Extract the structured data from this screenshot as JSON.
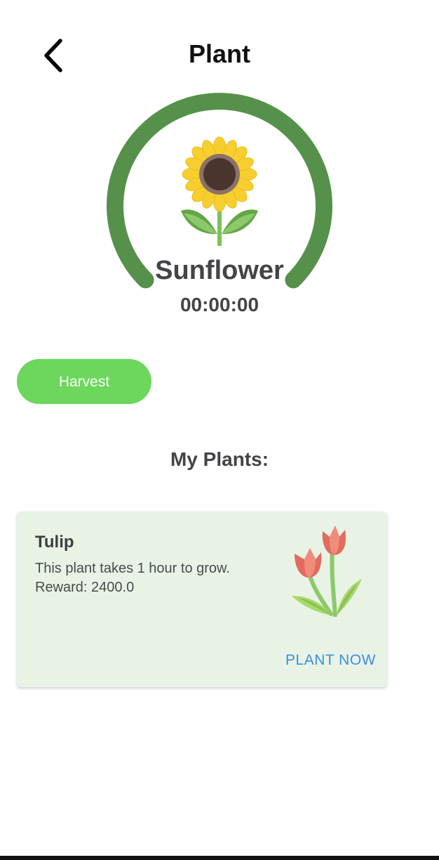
{
  "header": {
    "title": "Plant",
    "back_icon": "chevron-left-icon"
  },
  "current_plant": {
    "name": "Sunflower",
    "timer": "00:00:00",
    "icon": "sunflower-icon",
    "progress_ring_color": "#55914a"
  },
  "actions": {
    "harvest_label": "Harvest",
    "harvest_color": "#6dd65d"
  },
  "my_plants": {
    "title": "My Plants:",
    "items": [
      {
        "name": "Tulip",
        "description": "This plant takes 1 hour to grow.",
        "reward": "Reward: 2400.0",
        "icon": "tulip-icon",
        "action_label": "PLANT NOW"
      }
    ]
  },
  "colors": {
    "card_background": "#e8f3e6",
    "link_blue": "#3a8fe0",
    "text_dark": "#45434a"
  }
}
